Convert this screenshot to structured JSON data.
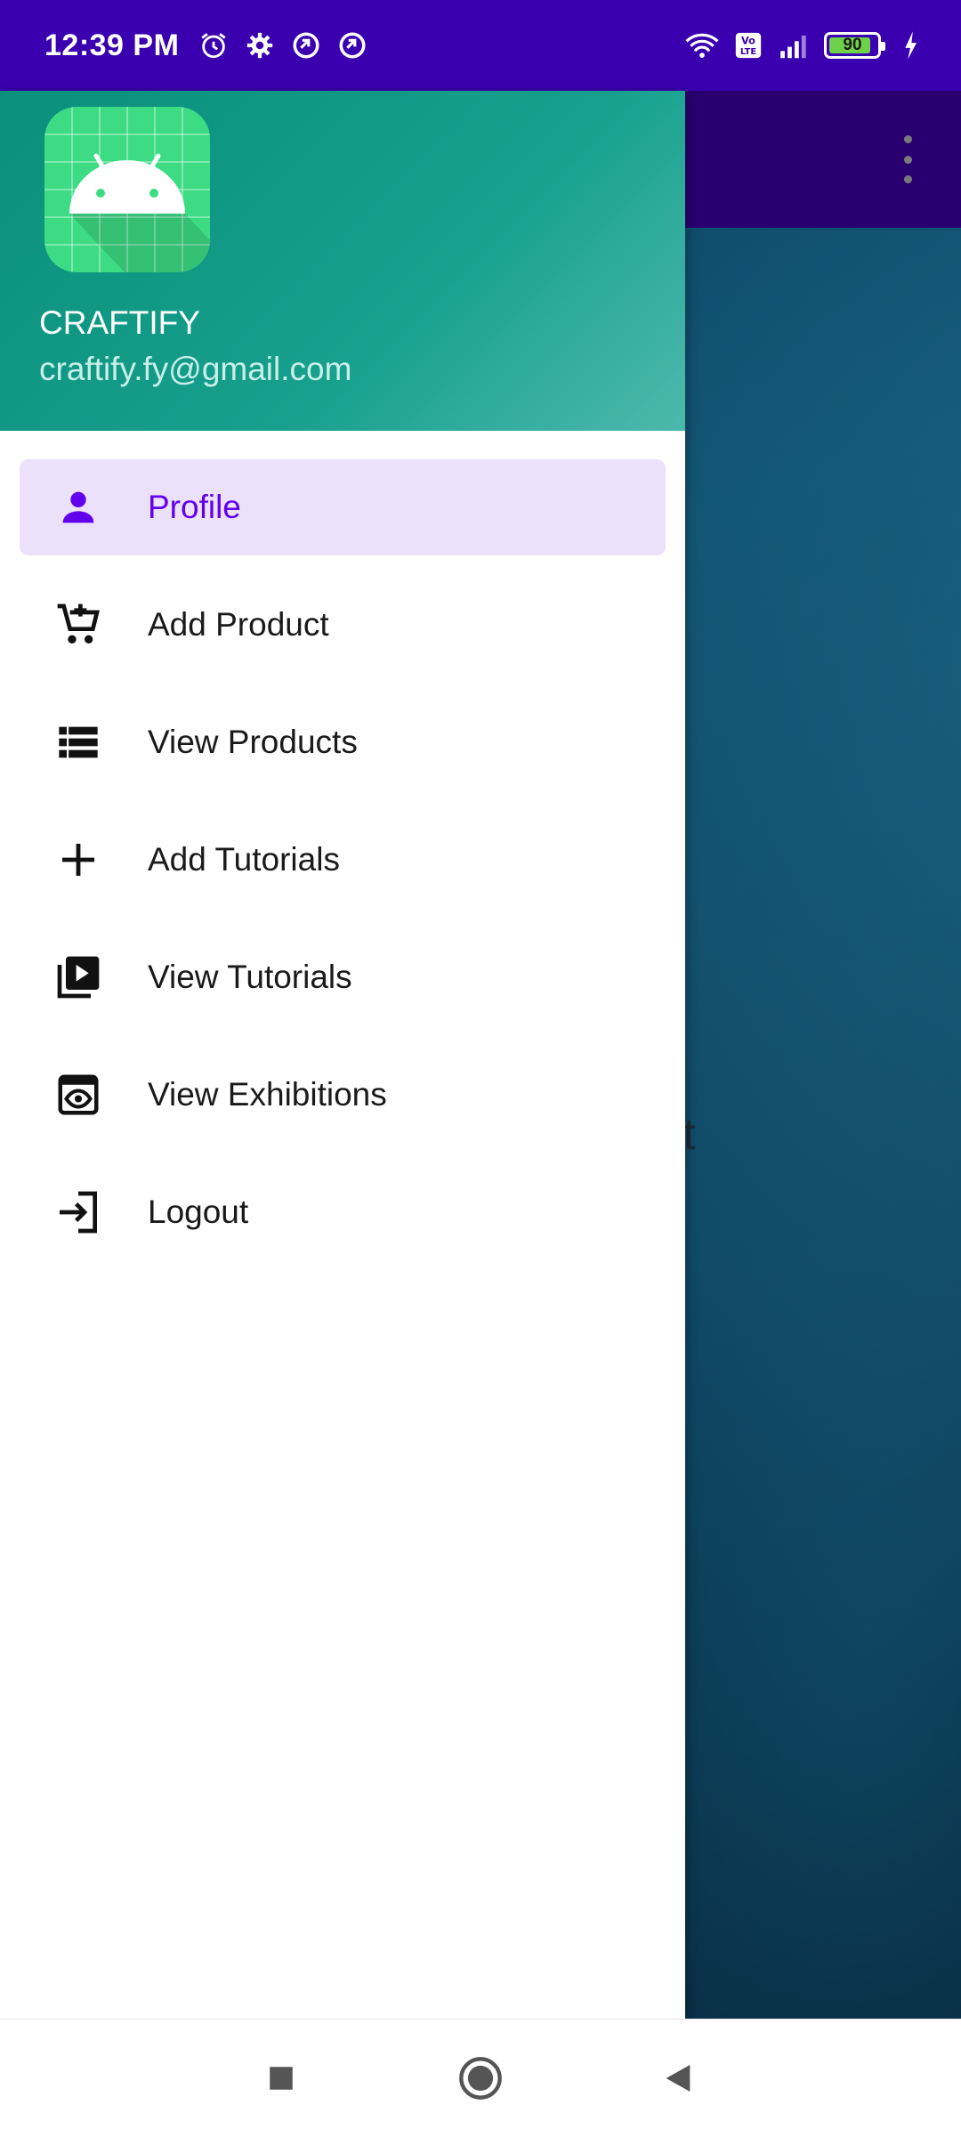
{
  "status_bar": {
    "time": "12:39 PM",
    "battery_percent": "90",
    "left_icons": [
      "alarm-icon",
      "settings-icon",
      "sync-icon",
      "sync-icon"
    ],
    "right_icons": [
      "wifi-icon",
      "volte-icon",
      "signal-icon",
      "battery-icon",
      "charging-icon"
    ]
  },
  "background_app": {
    "partial_text": "nt",
    "overflow_icon": "more-vert-icon"
  },
  "drawer": {
    "header": {
      "logo_icon": "android-icon",
      "name": "CRAFTIFY",
      "email": "craftify.fy@gmail.com"
    },
    "items": [
      {
        "label": "Profile",
        "icon": "person-icon",
        "selected": true
      },
      {
        "label": "Add Product",
        "icon": "add-shopping-cart-icon",
        "selected": false
      },
      {
        "label": "View Products",
        "icon": "view-list-icon",
        "selected": false
      },
      {
        "label": "Add Tutorials",
        "icon": "add-icon",
        "selected": false
      },
      {
        "label": "View Tutorials",
        "icon": "video-library-icon",
        "selected": false
      },
      {
        "label": "View Exhibitions",
        "icon": "preview-icon",
        "selected": false
      },
      {
        "label": "Logout",
        "icon": "login-icon",
        "selected": false
      }
    ]
  },
  "nav_bar": {
    "buttons": [
      "recents-icon",
      "home-icon",
      "back-icon"
    ]
  },
  "colors": {
    "status_bar": "#3a00b0",
    "toolbar": "#2a0070",
    "drawer_header": "#17a08d",
    "selected_item_bg": "#ece1fb",
    "selected_item_text": "#6200ee"
  }
}
